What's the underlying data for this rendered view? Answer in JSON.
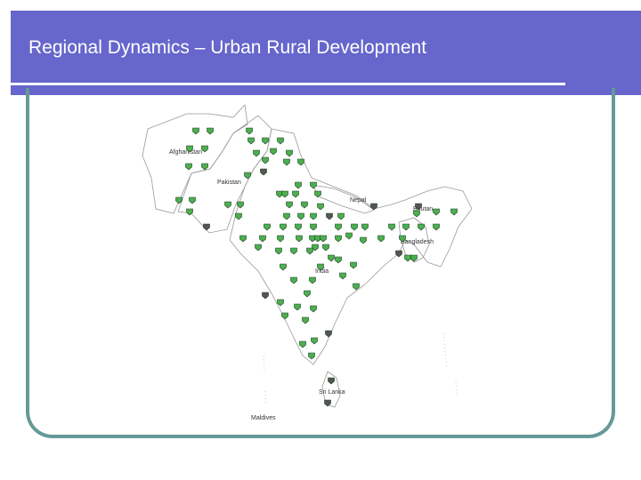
{
  "slide": {
    "title": "Regional Dynamics – Urban Rural Development"
  },
  "map": {
    "labels": {
      "afghanistan": "Afghanistan",
      "pakistan": "Pakistan",
      "nepal": "Nepal",
      "bhutan": "Bhutan",
      "bangladesh": "Bangladesh",
      "india": "India",
      "sri_lanka": "Sri Lanka",
      "maldives": "Maldives"
    },
    "colors": {
      "green_marker": "#4caf50",
      "dark_marker": "#555555",
      "border": "#999999"
    }
  }
}
